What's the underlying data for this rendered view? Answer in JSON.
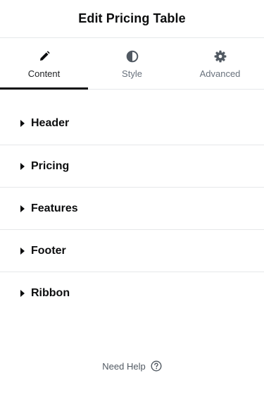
{
  "header": {
    "title": "Edit Pricing Table"
  },
  "tabs": [
    {
      "label": "Content",
      "icon": "pencil-icon",
      "active": true
    },
    {
      "label": "Style",
      "icon": "half-circle-icon",
      "active": false
    },
    {
      "label": "Advanced",
      "icon": "gear-icon",
      "active": false
    }
  ],
  "sections": [
    {
      "label": "Header"
    },
    {
      "label": "Pricing"
    },
    {
      "label": "Features"
    },
    {
      "label": "Footer"
    },
    {
      "label": "Ribbon"
    }
  ],
  "help": {
    "label": "Need Help",
    "icon": "question-circle-icon"
  },
  "colors": {
    "text": "#0c0d0e",
    "muted": "#69727d",
    "divider": "#e6e8ea",
    "active_tab": "#0c0d0e"
  }
}
